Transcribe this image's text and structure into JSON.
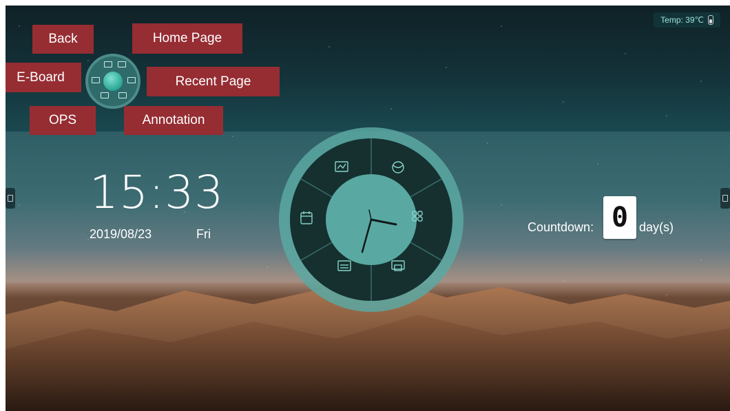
{
  "status": {
    "temperature": "Temp: 39℃"
  },
  "menu": {
    "back": "Back",
    "home_page": "Home Page",
    "e_board": "E-Board",
    "recent_page": "Recent Page",
    "ops": "OPS",
    "annotation": "Annotation"
  },
  "clock": {
    "time": "15:33",
    "date": "2019/08/23",
    "weekday": "Fri"
  },
  "countdown": {
    "label": "Countdown:",
    "value": "0",
    "unit": "day(s)"
  },
  "dial": {
    "icons": [
      "whiteboard-icon",
      "browser-icon",
      "apps-icon",
      "screen-share-icon",
      "media-icon",
      "calendar-icon"
    ],
    "clock_hands": {
      "hour": 3,
      "minute": 33
    }
  },
  "colors": {
    "label_bg": "#962d33",
    "dial_ring": "#5aa8a2",
    "dial_dark": "#15302f",
    "accent": "#9be4dc"
  }
}
